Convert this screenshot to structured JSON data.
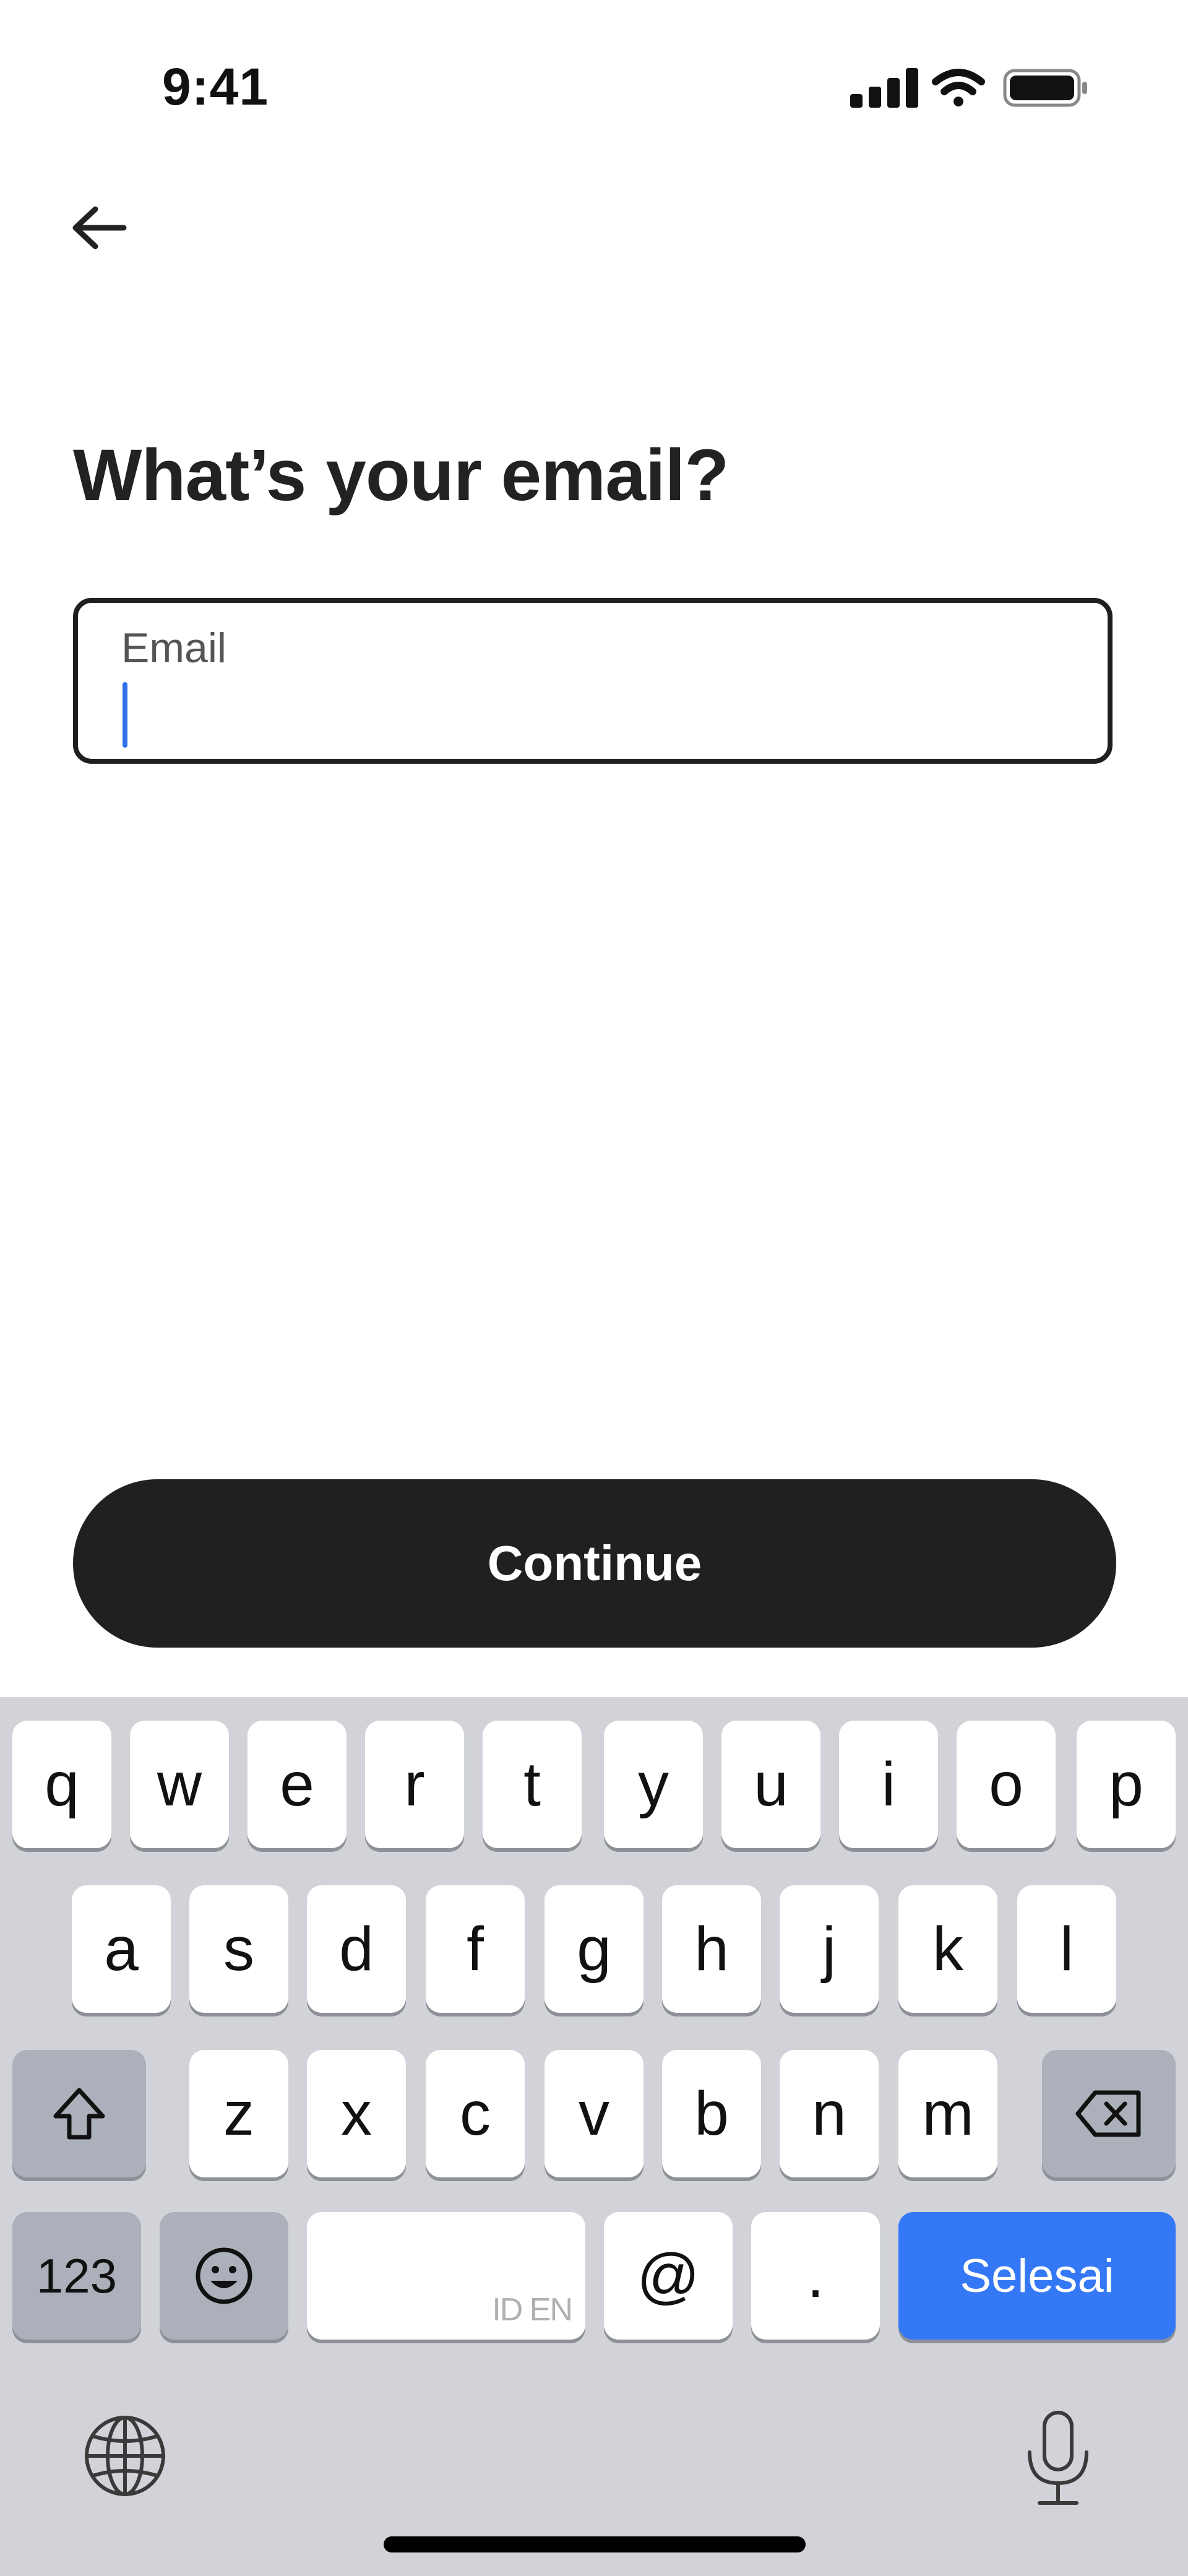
{
  "status_bar": {
    "time": "9:41",
    "signal_icon": "cellular-signal-icon",
    "wifi_icon": "wifi-icon",
    "battery_icon": "battery-icon"
  },
  "header": {
    "back_icon": "arrow-left-icon"
  },
  "main": {
    "title": "What’s your email?",
    "email": {
      "label": "Email",
      "value": ""
    },
    "continue_label": "Continue"
  },
  "keyboard": {
    "row1": [
      "q",
      "w",
      "e",
      "r",
      "t",
      "y",
      "u",
      "i",
      "o",
      "p"
    ],
    "row2": [
      "a",
      "s",
      "d",
      "f",
      "g",
      "h",
      "j",
      "k",
      "l"
    ],
    "row3": [
      "z",
      "x",
      "c",
      "v",
      "b",
      "n",
      "m"
    ],
    "numbers_label": "123",
    "space_label": "ID EN",
    "at_label": "@",
    "dot_label": ".",
    "done_label": "Selesai",
    "shift_icon": "shift-icon",
    "backspace_icon": "backspace-icon",
    "emoji_icon": "emoji-icon",
    "globe_icon": "globe-icon",
    "mic_icon": "microphone-icon"
  },
  "colors": {
    "accent": "#3478f6",
    "button_bg": "#202020",
    "keyboard_bg": "#d1d3d9",
    "caret": "#2f6fe8"
  }
}
